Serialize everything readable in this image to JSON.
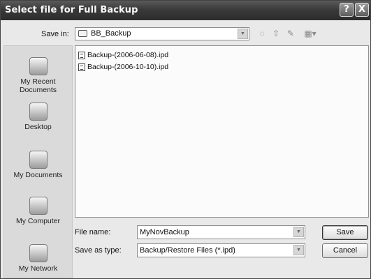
{
  "window": {
    "title": "Select file for Full Backup",
    "help_glyph": "?",
    "close_glyph": "X"
  },
  "save_in": {
    "label": "Save in:",
    "value": "BB_Backup",
    "arrow_glyph": "▼"
  },
  "toolbar": {
    "back_glyph": "◌",
    "up_glyph": "⇧",
    "new_folder_glyph": "✎",
    "views_glyph": "▦▾"
  },
  "places": [
    {
      "label": "My Recent Documents",
      "icon": "recent-documents-icon"
    },
    {
      "label": "Desktop",
      "icon": "desktop-icon"
    },
    {
      "label": "My Documents",
      "icon": "my-documents-icon"
    },
    {
      "label": "My Computer",
      "icon": "my-computer-icon"
    },
    {
      "label": "My Network",
      "icon": "my-network-icon"
    }
  ],
  "files": [
    {
      "name": "Backup-(2006-06-08).ipd"
    },
    {
      "name": "Backup-(2006-10-10).ipd"
    }
  ],
  "file_name": {
    "label": "File name:",
    "value": "MyNovBackup"
  },
  "save_as_type": {
    "label": "Save as type:",
    "value": "Backup/Restore Files (*.ipd)"
  },
  "buttons": {
    "save": "Save",
    "cancel": "Cancel"
  }
}
